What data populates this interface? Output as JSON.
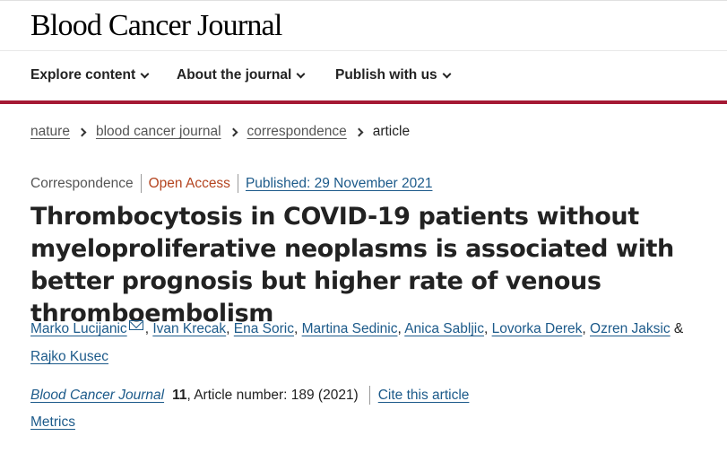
{
  "header": {
    "logo": "Blood Cancer Journal"
  },
  "nav": {
    "items": [
      {
        "label": "Explore content"
      },
      {
        "label": "About the journal"
      },
      {
        "label": "Publish with us"
      }
    ]
  },
  "breadcrumb": {
    "items": [
      "nature",
      "blood cancer journal",
      "correspondence"
    ],
    "current": "article"
  },
  "article": {
    "type": "Correspondence",
    "access": "Open Access",
    "published": "Published: 29 November 2021",
    "title": "Thrombocytosis in COVID-19 patients without myeloproliferative neoplasms is associated with better prognosis but higher rate of venous thromboembolism",
    "authors": [
      "Marko Lucijanic",
      "Ivan Krecak",
      "Ena Soric",
      "Martina Sedinic",
      "Anica Sabljic",
      "Lovorka Derek",
      "Ozren Jaksic",
      "Rajko Kusec"
    ],
    "authors_sep": ", ",
    "authors_last_sep": " & ",
    "journal": "Blood Cancer Journal",
    "volume": "11",
    "article_number": ", Article number: 189 (2021)",
    "cite_label": "Cite this article",
    "metrics_label": "Metrics"
  },
  "colors": {
    "accent": "#a51934",
    "link": "#1c5a8a",
    "open_access": "#b4441f"
  }
}
